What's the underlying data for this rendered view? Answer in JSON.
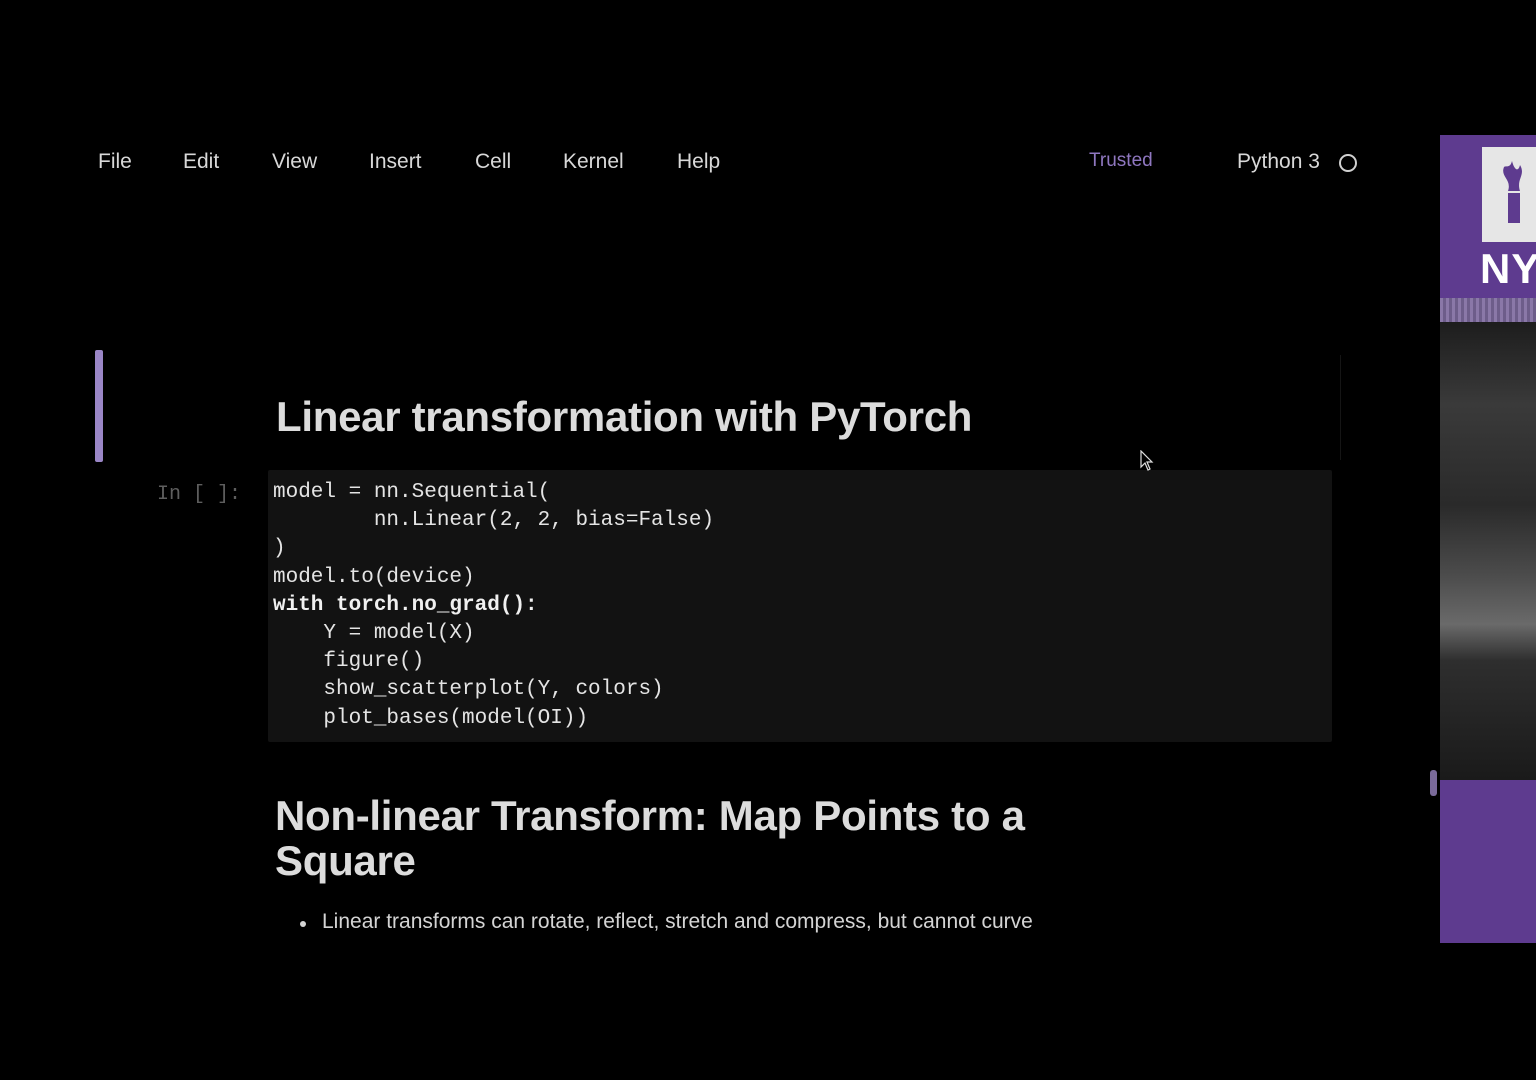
{
  "menu": {
    "items": [
      {
        "label": "File"
      },
      {
        "label": "Edit"
      },
      {
        "label": "View"
      },
      {
        "label": "Insert"
      },
      {
        "label": "Cell"
      },
      {
        "label": "Kernel"
      },
      {
        "label": "Help"
      }
    ],
    "trusted_label": "Trusted",
    "kernel_name": "Python 3"
  },
  "cells": {
    "heading_1": "Linear transformation with PyTorch",
    "code_prompt": "In [ ]:",
    "code_lines": [
      "model = nn.Sequential(",
      "        nn.Linear(2, 2, bias=False)",
      ")",
      "model.to(device)",
      "with torch.no_grad():",
      "    Y = model(X)",
      "    figure()",
      "    show_scatterplot(Y, colors)",
      "    plot_bases(model(OI))"
    ],
    "heading_2": "Non-linear Transform: Map Points to a Square",
    "bullets": [
      "Linear transforms can rotate, reflect, stretch and compress, but cannot curve"
    ]
  },
  "side_panel": {
    "logo_text": "NY"
  },
  "colors": {
    "accent": "#5e3b8f",
    "selected_bar": "#9a86c6",
    "trusted": "#8f77c0"
  }
}
